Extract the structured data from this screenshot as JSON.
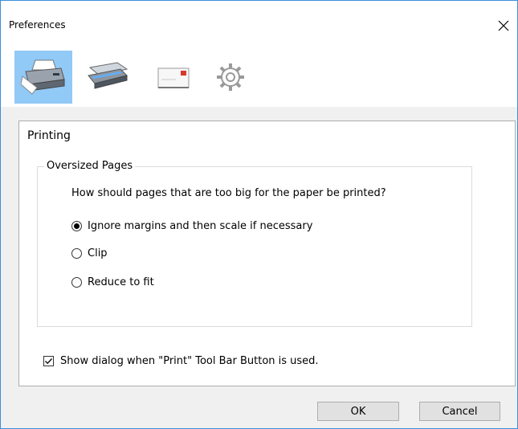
{
  "window": {
    "title": "Preferences",
    "accent_color": "#3c8edb"
  },
  "toolbar": {
    "items": [
      {
        "icon": "printer-icon",
        "selected": true
      },
      {
        "icon": "scanner-icon",
        "selected": false
      },
      {
        "icon": "envelope-icon",
        "selected": false
      },
      {
        "icon": "gear-icon",
        "selected": false
      }
    ],
    "selected_color": "#91c9f7"
  },
  "panel": {
    "title": "Printing",
    "group": {
      "legend": "Oversized Pages",
      "question": "How should pages that are too big for the paper be printed?",
      "options": [
        {
          "label": "Ignore margins and then scale if necessary",
          "checked": true
        },
        {
          "label": "Clip",
          "checked": false
        },
        {
          "label": "Reduce to fit",
          "checked": false
        }
      ]
    },
    "show_dialog": {
      "label": "Show dialog when \"Print\" Tool Bar Button is used.",
      "checked": true
    }
  },
  "buttons": {
    "ok": "OK",
    "cancel": "Cancel"
  }
}
